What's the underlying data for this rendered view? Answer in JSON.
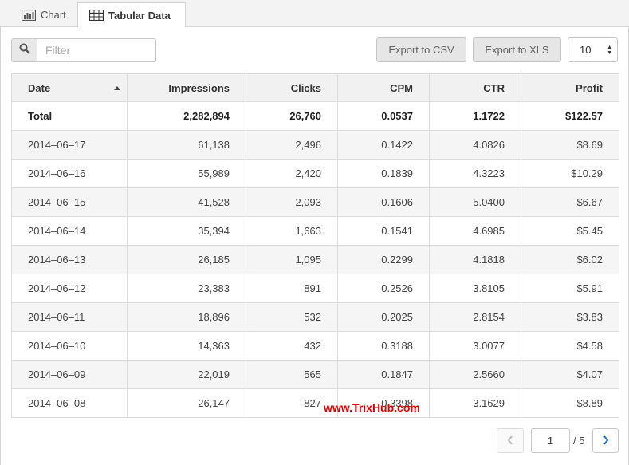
{
  "tabs": [
    {
      "label": "Chart",
      "icon": "bar-chart-icon",
      "active": false
    },
    {
      "label": "Tabular Data",
      "icon": "table-icon",
      "active": true
    }
  ],
  "toolbar": {
    "filter_placeholder": "Filter",
    "export_csv_label": "Export to CSV",
    "export_xls_label": "Export to XLS",
    "page_size": "10"
  },
  "table": {
    "columns": [
      "Date",
      "Impressions",
      "Clicks",
      "CPM",
      "CTR",
      "Profit"
    ],
    "sort": {
      "column": "Date",
      "direction": "ascending"
    },
    "total": [
      "Total",
      "2,282,894",
      "26,760",
      "0.0537",
      "1.1722",
      "$122.57"
    ],
    "rows": [
      [
        "2014–06–17",
        "61,138",
        "2,496",
        "0.1422",
        "4.0826",
        "$8.69"
      ],
      [
        "2014–06–16",
        "55,989",
        "2,420",
        "0.1839",
        "4.3223",
        "$10.29"
      ],
      [
        "2014–06–15",
        "41,528",
        "2,093",
        "0.1606",
        "5.0400",
        "$6.67"
      ],
      [
        "2014–06–14",
        "35,394",
        "1,663",
        "0.1541",
        "4.6985",
        "$5.45"
      ],
      [
        "2014–06–13",
        "26,185",
        "1,095",
        "0.2299",
        "4.1818",
        "$6.02"
      ],
      [
        "2014–06–12",
        "23,383",
        "891",
        "0.2526",
        "3.8105",
        "$5.91"
      ],
      [
        "2014–06–11",
        "18,896",
        "532",
        "0.2025",
        "2.8154",
        "$3.83"
      ],
      [
        "2014–06–10",
        "14,363",
        "432",
        "0.3188",
        "3.0077",
        "$4.58"
      ],
      [
        "2014–06–09",
        "22,019",
        "565",
        "0.1847",
        "2.5660",
        "$4.07"
      ],
      [
        "2014–06–08",
        "26,147",
        "827",
        "0.3398",
        "3.1629",
        "$8.89"
      ]
    ]
  },
  "pager": {
    "current_page": "1",
    "total_label": "/ 5"
  },
  "watermark": "www.TrixHub.com",
  "colors": {
    "watermark": "#e60000",
    "next_arrow": "#2a6ebb",
    "header_bg": "#f1f1f1",
    "stripe_bg": "#f5f5f5"
  }
}
